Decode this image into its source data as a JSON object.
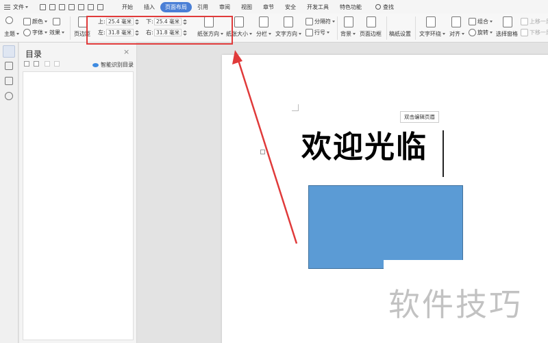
{
  "menubar": {
    "file_label": "文件",
    "tabs": [
      "开始",
      "插入",
      "页面布局",
      "引用",
      "审阅",
      "视图",
      "章节",
      "安全",
      "开发工具",
      "特色功能"
    ],
    "active_tab": "页面布局",
    "search_label": "查找"
  },
  "ribbon": {
    "theme_label": "主题",
    "colors_label": "颜色",
    "fonts_label": "字体",
    "effects_label": "效果",
    "margins_label": "页边距",
    "margin_top_label": "上:",
    "margin_top_value": "25.4 毫米",
    "margin_bottom_label": "下:",
    "margin_bottom_value": "25.4 毫米",
    "margin_left_label": "左:",
    "margin_left_value": "31.8 毫米",
    "margin_right_label": "右:",
    "margin_right_value": "31.8 毫米",
    "orientation_label": "纸张方向",
    "size_label": "纸张大小",
    "columns_label": "分栏",
    "text_direction_label": "文字方向",
    "separator_label": "分隔符",
    "line_number_label": "行号",
    "background_label": "背景",
    "page_border_label": "页面边框",
    "manuscript_label": "稿纸设置",
    "text_wrap_label": "文字环绕",
    "align_label": "对齐",
    "group_label": "组合",
    "rotate_label": "旋转",
    "select_pane_label": "选择窗格",
    "bring_forward_label": "上移一层",
    "send_backward_label": "下移一层"
  },
  "toc_panel": {
    "title": "目录",
    "close_glyph": "×",
    "smart_toc_label": "智能识别目录"
  },
  "document": {
    "header_tip": "双击编辑页眉",
    "heading": "欢迎光临",
    "shape_color": "#5b9bd5"
  },
  "watermark": "软件技巧",
  "annotation": {
    "box_color": "#e03a3a"
  }
}
